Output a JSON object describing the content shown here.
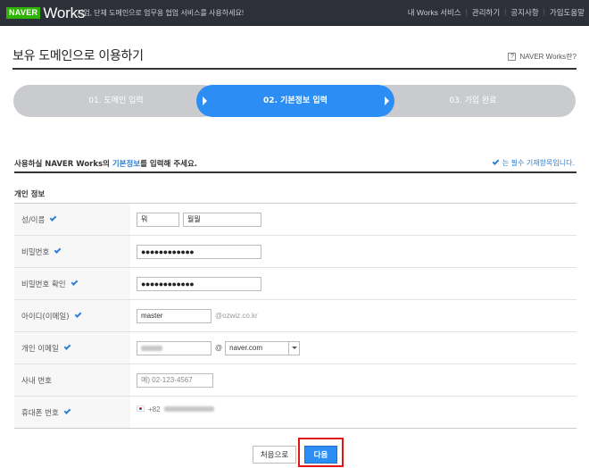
{
  "header": {
    "logo_naver": "NAVER",
    "logo_works": "Works",
    "tagline": "기업, 단체 도메인으로 업무용 협업 서비스를 사용하세요!",
    "nav": [
      "내 Works 서비스",
      "관리하기",
      "공지사항",
      "가입도움말"
    ]
  },
  "page": {
    "title": "보유 도메인으로 이용하기",
    "help_link": "NAVER Works란?",
    "help_icon_glyph": "?"
  },
  "steps": [
    {
      "label": "01.  도메인 입력",
      "state": "inactive"
    },
    {
      "label": "02. 기본정보 입력",
      "state": "active"
    },
    {
      "label": "03.  가입 완료",
      "state": "inactive"
    }
  ],
  "instruction": {
    "prefix": "사용하실 NAVER Works의 ",
    "highlight": "기본정보",
    "suffix": "를 입력해 주세요.",
    "required_note": "는 필수 기재항목입니다."
  },
  "section_label": "개인 정보",
  "form": {
    "name": {
      "label": "성/이름",
      "required": true,
      "surname": "뭐",
      "given": "뭘뭘"
    },
    "password": {
      "label": "비밀번호",
      "required": true,
      "value": "●●●●●●●●●●●●"
    },
    "password_confirm": {
      "label": "비밀번호 확인",
      "required": true,
      "value": "●●●●●●●●●●●●"
    },
    "id_email": {
      "label": "아이디(이메일)",
      "required": true,
      "value": "master",
      "domain_suffix": "@ozwiz.co.kr"
    },
    "personal_email": {
      "label": "개인 이메일",
      "required": true,
      "at": "@",
      "domain": "naver.com"
    },
    "office_phone": {
      "label": "사내 번호",
      "required": false,
      "placeholder": "예) 02-123-4567"
    },
    "mobile_phone": {
      "label": "휴대폰 번호",
      "required": true,
      "country_code": "+82"
    }
  },
  "buttons": {
    "first": "처음으로",
    "next": "다음"
  },
  "colors": {
    "accent": "#2c8ef5",
    "highlight_frame": "#e01515",
    "topbar": "#2d3038",
    "naver_green": "#2db400"
  }
}
